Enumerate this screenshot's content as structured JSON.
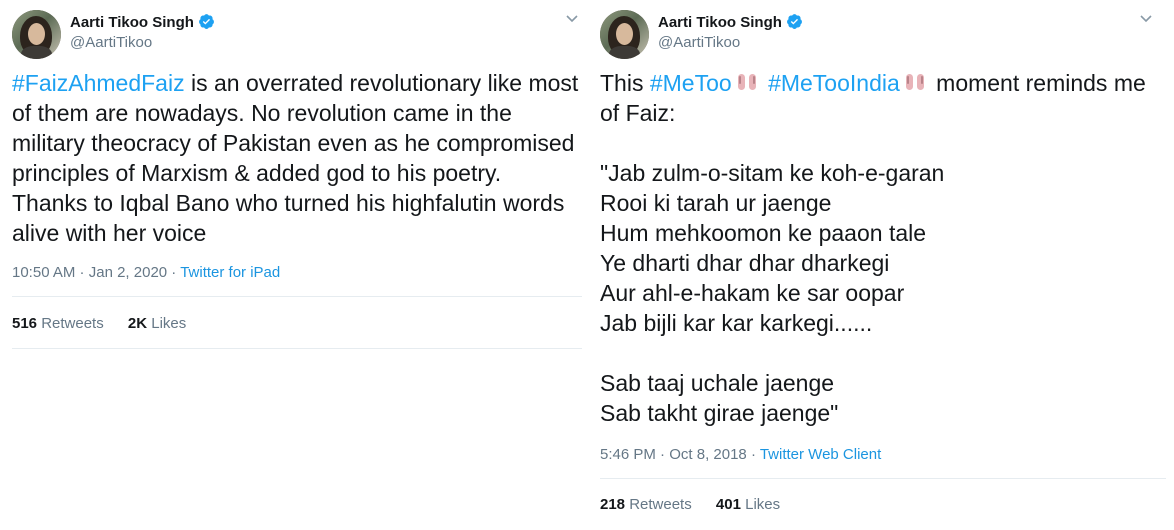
{
  "tweets": [
    {
      "author": {
        "name": "Aarti Tikoo Singh",
        "handle": "@AartiTikoo"
      },
      "hashtag": "#FaizAhmedFaiz",
      "text": " is an overrated revolutionary like most of them are nowadays. No revolution came in the military theocracy of Pakistan even as he compromised principles of Marxism & added god to his poetry. Thanks to Iqbal Bano who turned his highfalutin words alive with her voice",
      "time": "10:50 AM",
      "date": "Jan 2, 2020",
      "separator": " · ",
      "source": "Twitter for iPad",
      "retweets_count": "516",
      "retweets_label": " Retweets",
      "likes_count": "2K",
      "likes_label": " Likes"
    },
    {
      "author": {
        "name": "Aarti Tikoo Singh",
        "handle": "@AartiTikoo"
      },
      "text_prefix": "This ",
      "hashtag1": "#MeToo",
      "hashtag2": "#MeTooIndia",
      "text_suffix": " moment reminds me of Faiz:",
      "poem": "\"Jab zulm-o-sitam ke koh-e-garan\nRooi ki tarah ur jaenge\nHum mehkoomon ke paaon tale\nYe dharti dhar dhar dharkegi\nAur ahl-e-hakam ke sar oopar\nJab bijli kar kar karkegi......\n\nSab taaj uchale jaenge\nSab takht girae jaenge\"",
      "time": "5:46 PM",
      "date": "Oct 8, 2018",
      "separator": " · ",
      "source": "Twitter Web Client",
      "retweets_count": "218",
      "retweets_label": " Retweets",
      "likes_count": "401",
      "likes_label": " Likes"
    }
  ],
  "colors": {
    "link": "#1da1f2",
    "muted": "#657786",
    "text": "#14171a",
    "verified": "#1da1f2"
  },
  "icons": [
    "verified-badge-icon",
    "chevron-down-icon",
    "raised-hand-icon"
  ]
}
